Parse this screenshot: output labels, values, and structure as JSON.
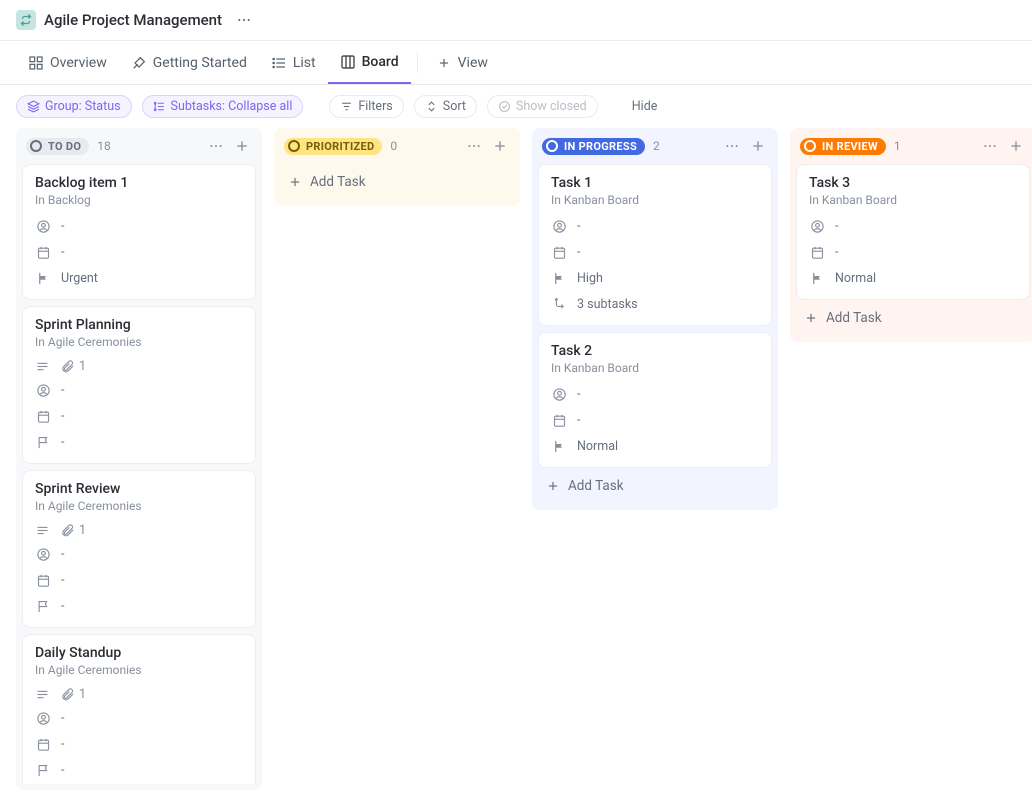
{
  "header": {
    "title": "Agile Project Management"
  },
  "tabs": {
    "overview": "Overview",
    "getting_started": "Getting Started",
    "list": "List",
    "board": "Board",
    "add_view": "View"
  },
  "toolbar": {
    "group": "Group: Status",
    "subtasks": "Subtasks: Collapse all",
    "filters": "Filters",
    "sort": "Sort",
    "show_closed": "Show closed",
    "hide": "Hide"
  },
  "common": {
    "add_task": "Add Task",
    "dash": "-"
  },
  "columns": {
    "todo": {
      "label": "TO DO",
      "count": "18"
    },
    "prio": {
      "label": "PRIORITIZED",
      "count": "0"
    },
    "prog": {
      "label": "IN PROGRESS",
      "count": "2"
    },
    "review": {
      "label": "IN REVIEW",
      "count": "1"
    }
  },
  "cards": {
    "todo": [
      {
        "title": "Backlog item 1",
        "sub": "In Backlog",
        "attach": null,
        "priority": "Urgent",
        "flag": "red"
      },
      {
        "title": "Sprint Planning",
        "sub": "In Agile Ceremonies",
        "attach": "1",
        "priority": "-",
        "flag": "grey"
      },
      {
        "title": "Sprint Review",
        "sub": "In Agile Ceremonies",
        "attach": "1",
        "priority": "-",
        "flag": "grey"
      },
      {
        "title": "Daily Standup",
        "sub": "In Agile Ceremonies",
        "attach": "1",
        "priority": "-",
        "flag": "grey"
      }
    ],
    "prog": [
      {
        "title": "Task 1",
        "sub": "In Kanban Board",
        "priority": "High",
        "flag": "yellow",
        "subtasks": "3 subtasks"
      },
      {
        "title": "Task 2",
        "sub": "In Kanban Board",
        "priority": "Normal",
        "flag": "blue"
      }
    ],
    "review": [
      {
        "title": "Task 3",
        "sub": "In Kanban Board",
        "priority": "Normal",
        "flag": "blue"
      }
    ]
  }
}
